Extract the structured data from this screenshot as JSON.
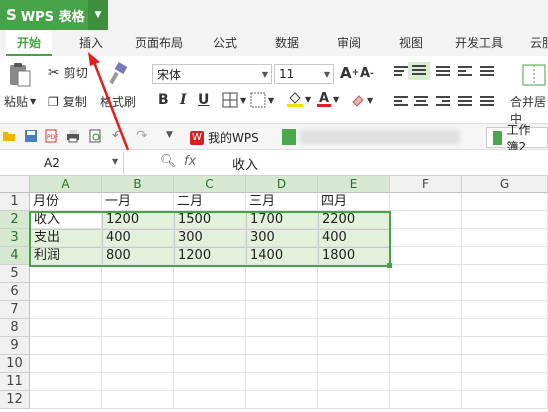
{
  "app": {
    "name": "WPS 表格",
    "logo": "S"
  },
  "tabs": [
    "开始",
    "插入",
    "页面布局",
    "公式",
    "数据",
    "审阅",
    "视图",
    "开发工具",
    "云服"
  ],
  "ribbon": {
    "paste": "粘贴",
    "cut": "剪切",
    "copy": "复制",
    "format_painter": "格式刷",
    "font_name": "宋体",
    "font_size": "11",
    "bold": "B",
    "italic": "I",
    "underline": "U",
    "font_grow": "A",
    "font_shrink": "A",
    "merge": "合并居中"
  },
  "quickbar": {
    "tab1": "我的WPS",
    "tab2": "工作簿2"
  },
  "formula": {
    "cell_ref": "A2",
    "fx": "fx",
    "content": "收入"
  },
  "columns": [
    "A",
    "B",
    "C",
    "D",
    "E",
    "F",
    "G"
  ],
  "rows": [
    "1",
    "2",
    "3",
    "4",
    "5",
    "6",
    "7",
    "8",
    "9",
    "10",
    "11",
    "12"
  ],
  "table": [
    [
      "月份",
      "一月",
      "二月",
      "三月",
      "四月"
    ],
    [
      "收入",
      "1200",
      "1500",
      "1700",
      "2200"
    ],
    [
      "支出",
      "400",
      "300",
      "300",
      "400"
    ],
    [
      "利润",
      "800",
      "1200",
      "1400",
      "1800"
    ]
  ],
  "colors": {
    "accent": "#47a347",
    "selection": "#e3f0dc",
    "arrow": "#e02020"
  }
}
